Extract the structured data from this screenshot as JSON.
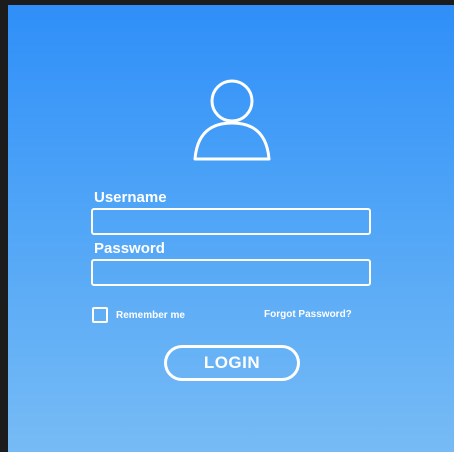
{
  "login_form": {
    "username_label": "Username",
    "username_value": "",
    "password_label": "Password",
    "password_value": "",
    "remember_label": "Remember me",
    "remember_checked": false,
    "forgot_label": "Forgot Password?",
    "login_label": "LOGIN"
  },
  "icons": {
    "avatar": "user-icon",
    "checkbox": "checkbox-icon"
  },
  "colors": {
    "gradient_top": "#2f8ff8",
    "gradient_bottom": "#77bbf5",
    "foreground": "#ffffff",
    "frame": "#1c1c1c"
  }
}
